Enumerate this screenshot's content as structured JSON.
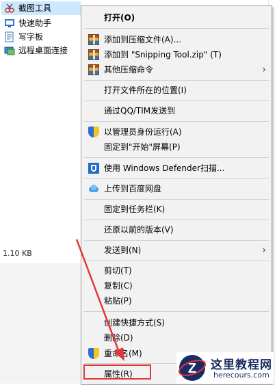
{
  "explorer": {
    "items": [
      {
        "label": "截图工具",
        "icon": "snipping-tool-icon"
      },
      {
        "label": "快速助手",
        "icon": "quick-assist-icon"
      },
      {
        "label": "写字板",
        "icon": "wordpad-icon"
      },
      {
        "label": "远程桌面连接",
        "icon": "remote-desktop-icon"
      }
    ],
    "size": "1.10 KB"
  },
  "menu": {
    "items": [
      {
        "label": "打开(O)",
        "bold": true
      },
      {
        "label": "添加到压缩文件(A)...",
        "icon": "archive-icon"
      },
      {
        "label": "添加到 \"Snipping Tool.zip\" (T)",
        "icon": "archive-icon"
      },
      {
        "label": "其他压缩命令",
        "icon": "archive-icon",
        "submenu": true
      },
      {
        "label": "打开文件所在的位置(I)"
      },
      {
        "label": "通过QQ/TIM发送到"
      },
      {
        "label": "以管理员身份运行(A)",
        "icon": "shield-icon"
      },
      {
        "label": "固定到\"开始\"屏幕(P)"
      },
      {
        "label": "使用 Windows Defender扫描...",
        "icon": "windows-defender-icon"
      },
      {
        "label": "上传到百度网盘",
        "icon": "baidu-cloud-icon"
      },
      {
        "label": "固定到任务栏(K)"
      },
      {
        "label": "还原以前的版本(V)"
      },
      {
        "label": "发送到(N)",
        "submenu": true
      },
      {
        "label": "剪切(T)"
      },
      {
        "label": "复制(C)"
      },
      {
        "label": "粘贴(P)"
      },
      {
        "label": "创建快捷方式(S)"
      },
      {
        "label": "删除(D)"
      },
      {
        "label": "重命名(M)",
        "icon": "shield-icon"
      },
      {
        "label": "属性(R)"
      }
    ]
  },
  "watermark": {
    "title": "这里教程网",
    "url": "herecours.com"
  },
  "colors": {
    "menu_bg": "#f2f2f2",
    "selection": "#cce8ff",
    "highlight": "#e0383b",
    "watermark_text": "#1a2d63"
  }
}
